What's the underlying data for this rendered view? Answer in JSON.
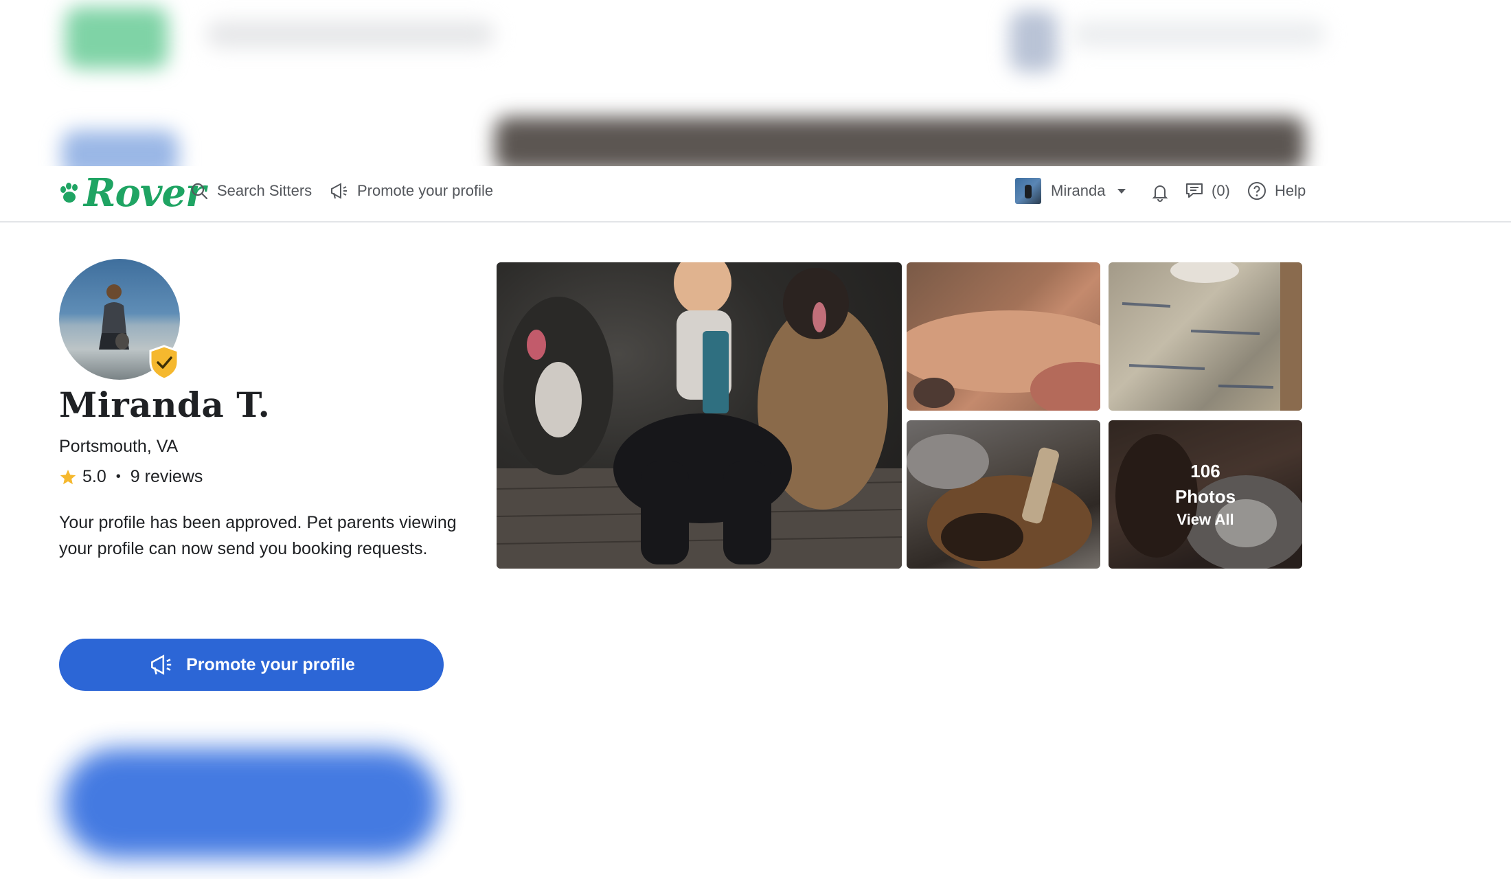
{
  "nav": {
    "logo_text": "Rover",
    "search_label": "Search Sitters",
    "promote_label": "Promote your profile",
    "user_name": "Miranda",
    "messages_count": "(0)",
    "help_label": "Help"
  },
  "profile": {
    "name": "Miranda T.",
    "location": "Portsmouth, VA",
    "rating": "5.0",
    "separator": "•",
    "reviews": "9 reviews",
    "approved_message": "Your profile has been approved. Pet parents viewing your profile can now send you booking requests.",
    "promote_button": "Promote your profile"
  },
  "photos": {
    "count": "106",
    "label": "Photos",
    "view_all": "View All"
  },
  "colors": {
    "brand_green": "#1fa463",
    "primary_blue": "#2c66d6",
    "star": "#f5b82e"
  }
}
